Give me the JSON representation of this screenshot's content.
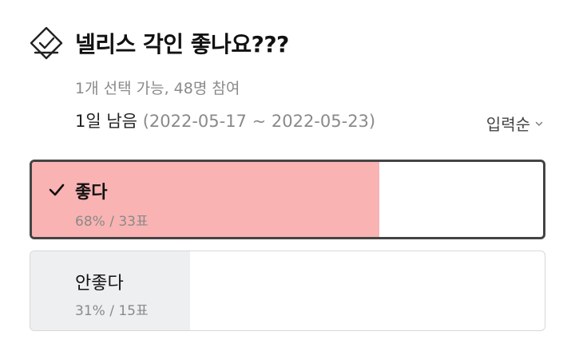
{
  "poll": {
    "icon": "ballot-check-icon",
    "title": "넬리스 각인 좋나요???",
    "meta": "1개 선택 가능, 48명 참여",
    "deadline_remaining": "1일 남음",
    "deadline_range": "(2022-05-17 ~ 2022-05-23)",
    "sort_label": "입력순",
    "sort_icon": "chevron-down-icon"
  },
  "options": [
    {
      "label": "좋다",
      "percent": 68,
      "stats": "68% / 33표",
      "selected": true,
      "check_icon": "check-icon",
      "color": "#f9b3b3"
    },
    {
      "label": "안좋다",
      "percent": 31,
      "stats": "31% / 15표",
      "selected": false,
      "color": "#eeeff1"
    }
  ],
  "colors": {
    "selected_border": "#444444",
    "muted_text": "#8a8a8a"
  }
}
